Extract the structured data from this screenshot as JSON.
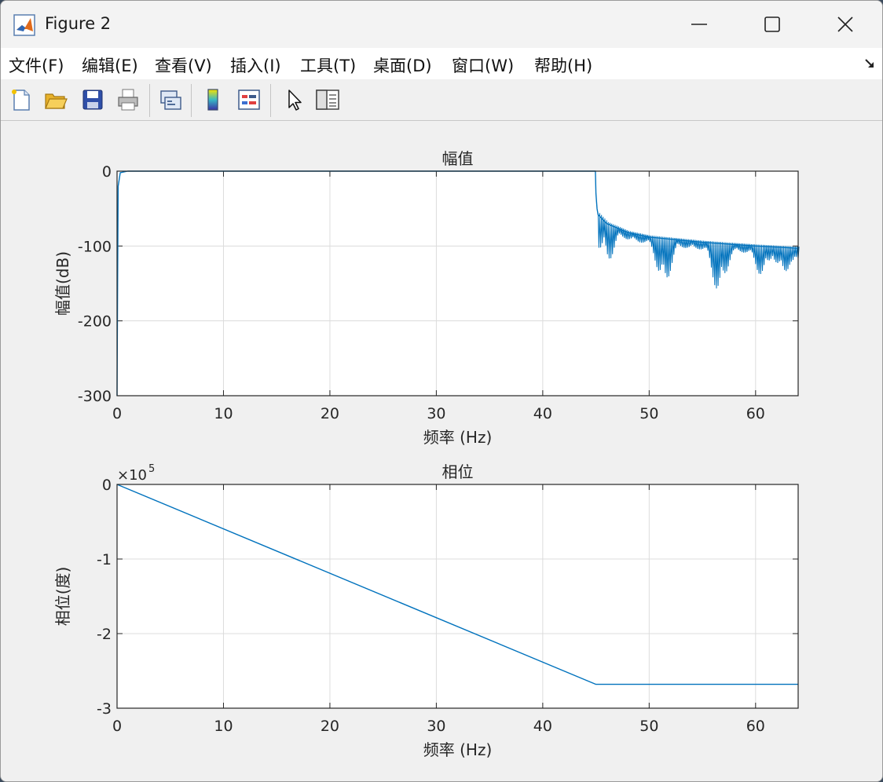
{
  "window": {
    "title": "Figure 2"
  },
  "menu": [
    "文件(F)",
    "编辑(E)",
    "查看(V)",
    "插入(I)",
    "工具(T)",
    "桌面(D)",
    "窗口(W)",
    "帮助(H)"
  ],
  "toolbar": {
    "icons": [
      "new-figure-icon",
      "open-file-icon",
      "save-icon",
      "print-icon",
      "link-plot-icon",
      "colorbar-icon",
      "legend-icon",
      "edit-plot-icon",
      "property-inspector-icon"
    ]
  },
  "colors": {
    "line": "#0072bd",
    "grid": "#dcdcdc",
    "axes_bg": "#ffffff"
  },
  "chart_data": [
    {
      "type": "line",
      "title": "幅值",
      "xlabel": "频率 (Hz)",
      "ylabel": "幅值(dB)",
      "xlim": [
        0,
        64
      ],
      "ylim": [
        -300,
        0
      ],
      "xticks": [
        "0",
        "10",
        "20",
        "30",
        "40",
        "50",
        "60"
      ],
      "yticks": [
        "0",
        "-100",
        "-200",
        "-300"
      ],
      "grid": true,
      "series": [
        {
          "x": [
            0,
            0.05,
            0.1,
            0.3,
            1,
            10,
            20,
            30,
            40,
            44.95,
            45,
            45.1,
            45.2,
            46,
            48,
            50,
            55,
            60,
            64
          ],
          "y": [
            -300,
            -150,
            -20,
            -2,
            0,
            0,
            0,
            0,
            0,
            0,
            -30,
            -50,
            -58,
            -70,
            -82,
            -88,
            -95,
            -100,
            -103
          ],
          "note_ripple_dips": [
            [
              45.5,
              -115
            ],
            [
              46,
              -120
            ],
            [
              51.3,
              -155
            ],
            [
              56.5,
              -165
            ],
            [
              60.5,
              -140
            ],
            [
              62.5,
              -138
            ],
            [
              63.5,
              -125
            ]
          ]
        }
      ]
    },
    {
      "type": "line",
      "title": "相位",
      "xlabel": "频率 (Hz)",
      "ylabel": "相位(度)",
      "exponent_label": "×10",
      "exponent_power": "5",
      "xlim": [
        0,
        64
      ],
      "ylim": [
        -3,
        0
      ],
      "xticks": [
        "0",
        "10",
        "20",
        "30",
        "40",
        "50",
        "60"
      ],
      "yticks": [
        "0",
        "-1",
        "-2",
        "-3"
      ],
      "grid": true,
      "series": [
        {
          "x": [
            0,
            45,
            64
          ],
          "y": [
            0,
            -2.68,
            -2.68
          ]
        }
      ]
    }
  ]
}
